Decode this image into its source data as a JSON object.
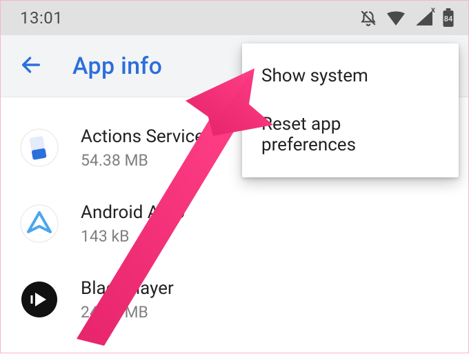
{
  "status": {
    "time": "13:01",
    "battery": "84"
  },
  "appbar": {
    "title": "App info"
  },
  "apps": [
    {
      "name": "Actions Services",
      "size": "54.38 MB"
    },
    {
      "name": "Android Auto",
      "size": "143 kB"
    },
    {
      "name": "BlackPlayer",
      "size": "24.93 MB"
    }
  ],
  "menu": {
    "show_system": "Show system",
    "reset": "Reset app preferences"
  },
  "colors": {
    "accent": "#2c6fdc",
    "annotation": "#e7246c"
  }
}
